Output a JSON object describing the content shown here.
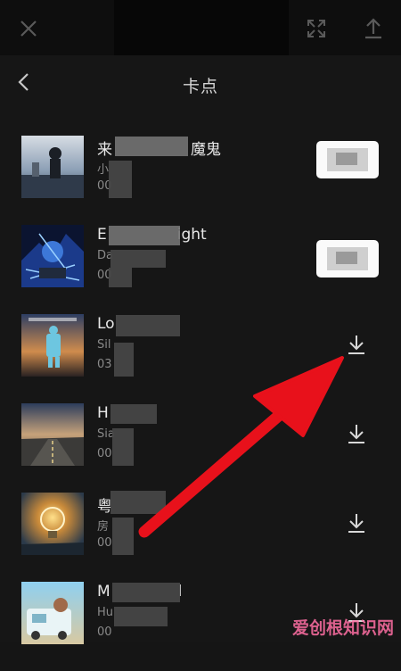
{
  "topbar": {
    "close_icon": "close-icon",
    "fullscreen_icon": "fullscreen-icon",
    "upload_icon": "upload-icon"
  },
  "header": {
    "title": "卡点",
    "back_icon": "chevron-left-icon"
  },
  "songs": [
    {
      "name_visible": "来",
      "name_tail": "魔鬼",
      "artist": "小",
      "duration": "00",
      "action": "use"
    },
    {
      "name_visible": "E",
      "name_tail": "ight",
      "artist": "Da",
      "duration": "00",
      "action": "use"
    },
    {
      "name_visible": "Lo",
      "name_tail": "",
      "artist": "Sil",
      "duration": "03",
      "action": "download"
    },
    {
      "name_visible": "H",
      "name_tail": "",
      "artist": "Sia",
      "duration": "00",
      "action": "download"
    },
    {
      "name_visible": "粤",
      "name_tail": "",
      "artist": "房",
      "duration": "00",
      "action": "download"
    },
    {
      "name_visible": "M",
      "name_tail": "l",
      "artist": "Hu",
      "duration": "00",
      "action": "download"
    }
  ],
  "colors": {
    "annotation_arrow": "#e8111b",
    "background": "#161616"
  },
  "watermark": "爱创根知识网"
}
